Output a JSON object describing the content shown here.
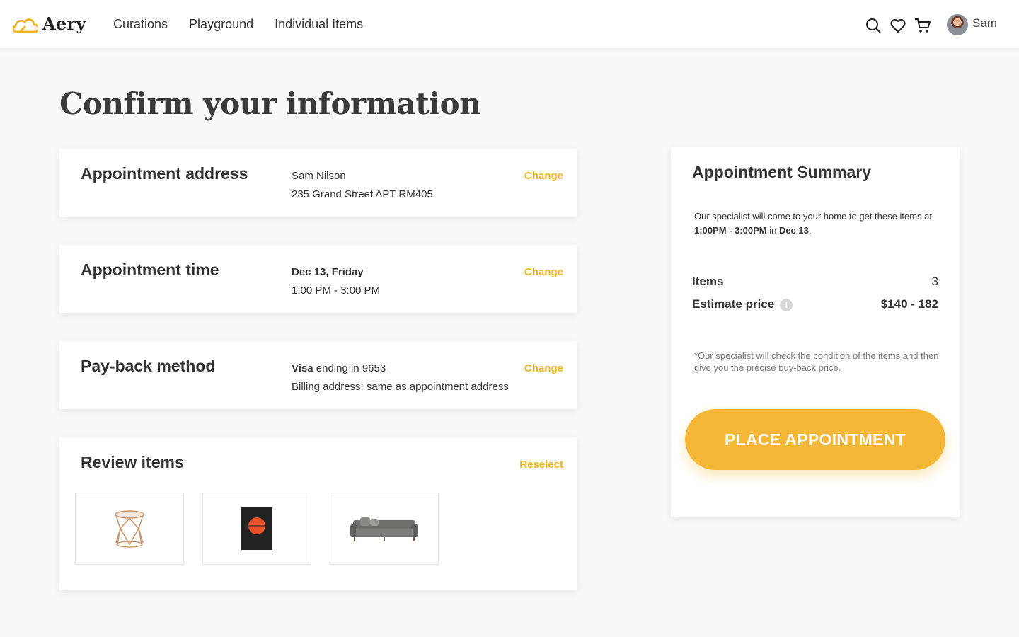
{
  "brand": {
    "name": "Aery",
    "accent": "#f0b323"
  },
  "nav": {
    "items": [
      "Curations",
      "Playground",
      "Individual Items"
    ]
  },
  "user": {
    "name": "Sam"
  },
  "page": {
    "title": "Confirm your information"
  },
  "address": {
    "title": "Appointment address",
    "name": "Sam Nilson",
    "street": "235 Grand Street APT RM405",
    "action": "Change"
  },
  "time": {
    "title": "Appointment time",
    "date": "Dec 13, Friday",
    "range": "1:00 PM - 3:00 PM",
    "action": "Change"
  },
  "payback": {
    "title": "Pay-back method",
    "card_brand": "Visa",
    "card_suffix": " ending in 9653",
    "billing": "Billing address: same as appointment address",
    "action": "Change"
  },
  "review": {
    "title": "Review items",
    "action": "Reselect",
    "items": [
      {
        "icon": "side-table-icon"
      },
      {
        "icon": "poster-icon"
      },
      {
        "icon": "sofa-icon"
      }
    ]
  },
  "summary": {
    "title": "Appointment Summary",
    "desc_prefix": "Our specialist will come to your home to get these items at ",
    "desc_time": "1:00PM - 3:00PM",
    "desc_mid": " in ",
    "desc_date": "Dec 13",
    "desc_suffix": ".",
    "items_label": "Items",
    "items_value": "3",
    "price_label": "Estimate price",
    "price_value": "$140 - 182",
    "note": "*Our specialist will check the condition of the items and then give you the precise buy-back price.",
    "button": "PLACE APPOINTMENT"
  }
}
